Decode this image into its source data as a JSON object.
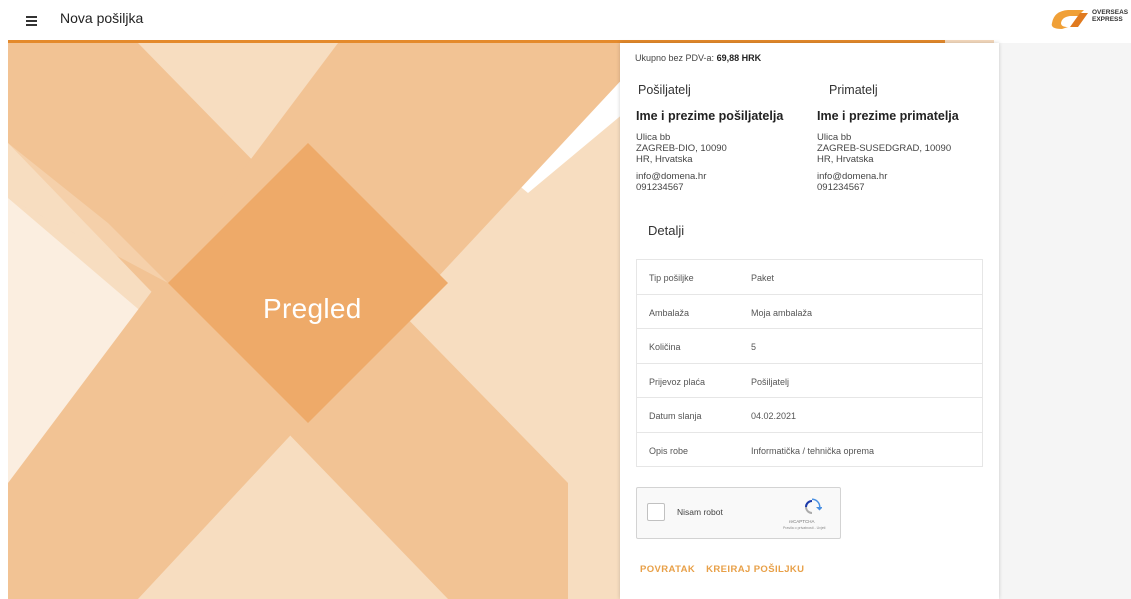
{
  "appbar": {
    "title": "Nova pošiljka",
    "menu_icon": "hamburger-menu-icon",
    "logo": {
      "line1": "OVERSEAS",
      "line2": "EXPRESS"
    }
  },
  "progress": {
    "percent": 95,
    "fill_color": "#e48a2c",
    "track_color": "#f4d9bd"
  },
  "hero": {
    "title": "Pregled"
  },
  "summary": {
    "total_label": "Ukupno bez PDV-a:",
    "total_value": "69,88 HRK"
  },
  "sender": {
    "heading": "Pošiljatelj",
    "name": "Ime i prezime pošiljatelja",
    "street": "Ulica bb",
    "city": "ZAGREB-DIO, 10090",
    "country": "HR, Hrvatska",
    "email": "info@domena.hr",
    "phone": "091234567"
  },
  "receiver": {
    "heading": "Primatelj",
    "name": "Ime i prezime primatelja",
    "street": "Ulica bb",
    "city": "ZAGREB-SUSEDGRAD, 10090",
    "country": "HR, Hrvatska",
    "email": "info@domena.hr",
    "phone": "091234567"
  },
  "details": {
    "heading": "Detalji",
    "rows": [
      {
        "label": "Tip pošiljke",
        "value": "Paket"
      },
      {
        "label": "Ambalaža",
        "value": "Moja ambalaža"
      },
      {
        "label": "Količina",
        "value": "5"
      },
      {
        "label": "Prijevoz plaća",
        "value": "Pošiljatelj"
      },
      {
        "label": "Datum slanja",
        "value": "04.02.2021"
      },
      {
        "label": "Opis robe",
        "value": "Informatička / tehnička oprema"
      }
    ]
  },
  "captcha": {
    "label": "Nisam robot",
    "brand": "reCAPTCHA",
    "terms": "Pravila o privatnosti - Uvjeti"
  },
  "actions": {
    "back": "POVRATAK",
    "create": "KREIRAJ POŠILJKU"
  },
  "colors": {
    "accent": "#e48a2c",
    "action_text": "#e8a048",
    "hero_dark": "#eeaa69",
    "hero_mid": "#f2c394",
    "hero_light": "#f7ddc0"
  }
}
